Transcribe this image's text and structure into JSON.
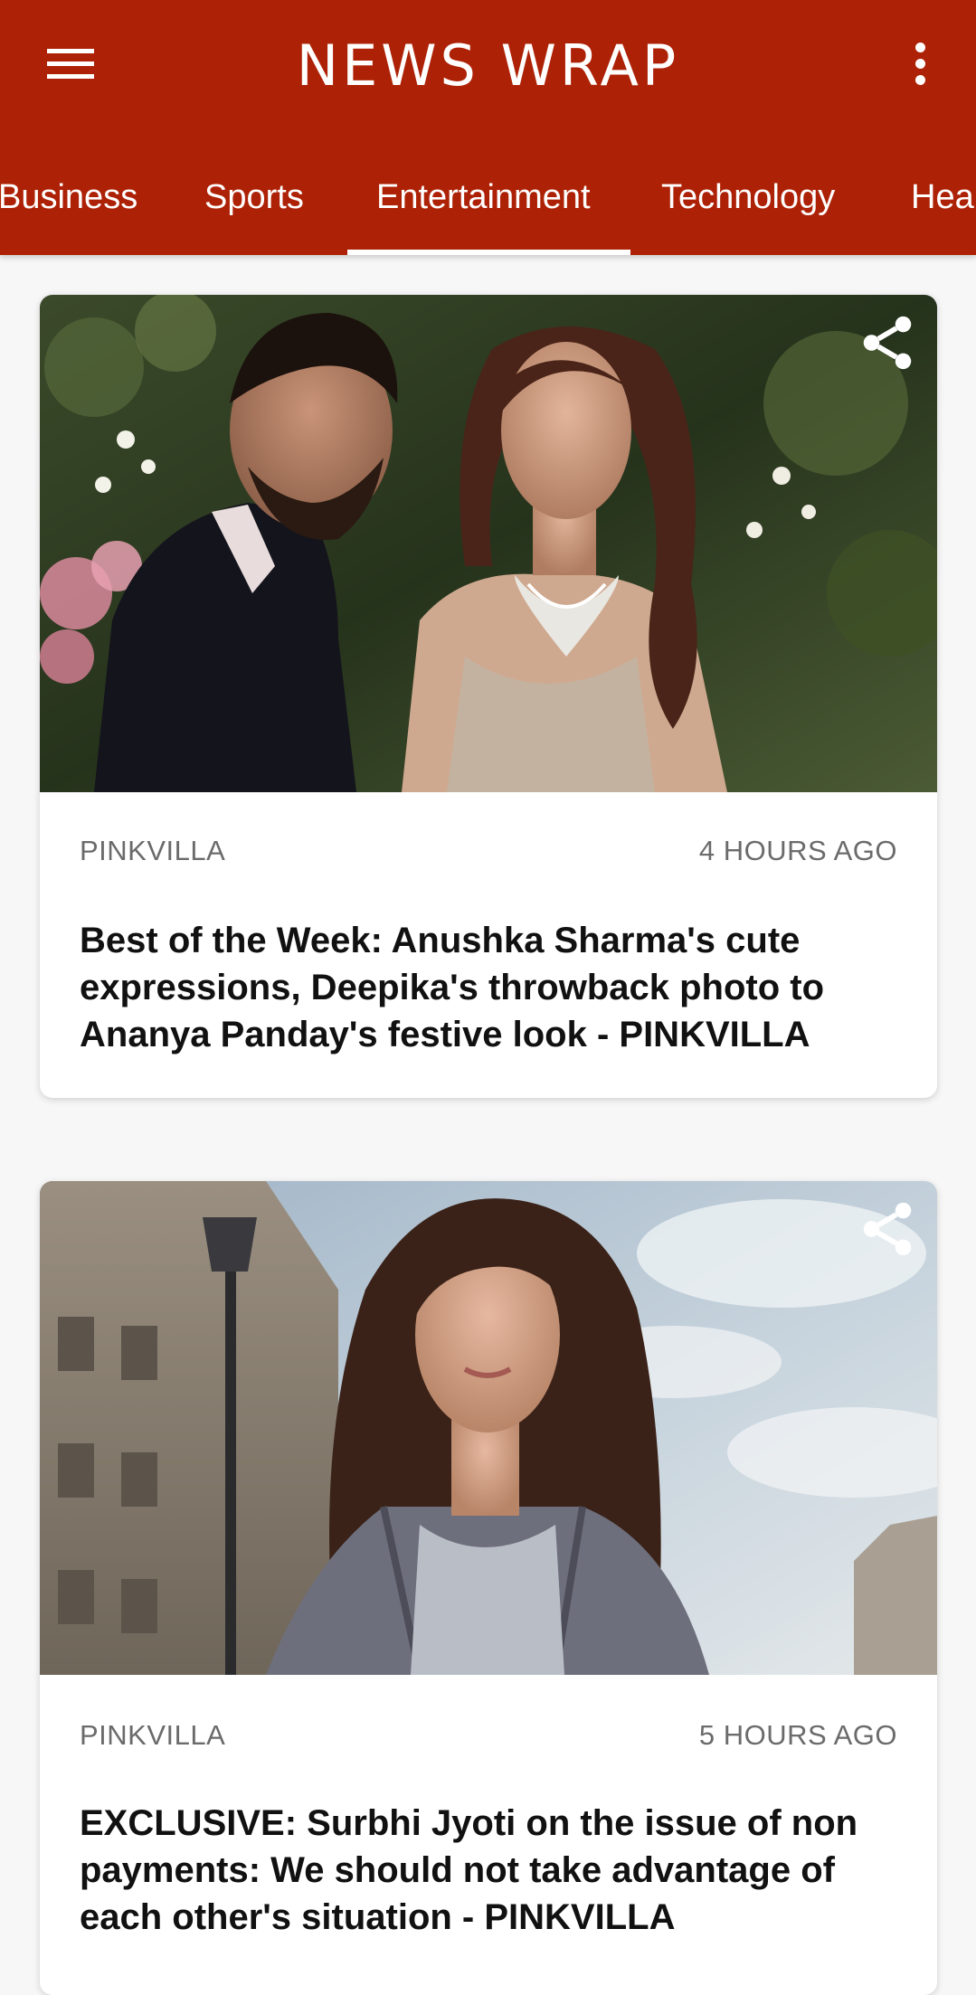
{
  "app": {
    "title": "NEWS WRAP",
    "menu_icon": "hamburger-menu-icon",
    "more_icon": "more-vertical-icon",
    "colors": {
      "primary": "#ad2206",
      "on_primary": "#ffffff",
      "background": "#f7f7f7"
    }
  },
  "tabs": [
    {
      "label": "Business",
      "active": false
    },
    {
      "label": "Sports",
      "active": false
    },
    {
      "label": "Entertainment",
      "active": true
    },
    {
      "label": "Technology",
      "active": false
    },
    {
      "label": "Hea",
      "active": false
    }
  ],
  "articles": [
    {
      "source": "PINKVILLA",
      "time": "4 HOURS AGO",
      "headline": "Best of the Week: Anushka Sharma's cute expressions, Deepika's throwback photo to Ananya Panday's festive look - PINKVILLA",
      "image_icon": "article-photo",
      "share_icon": "share-icon"
    },
    {
      "source": "PINKVILLA",
      "time": "5 HOURS AGO",
      "headline": "EXCLUSIVE: Surbhi Jyoti on the issue of non payments: We should not take advantage of each other's situation - PINKVILLA",
      "image_icon": "article-photo",
      "share_icon": "share-icon"
    }
  ]
}
